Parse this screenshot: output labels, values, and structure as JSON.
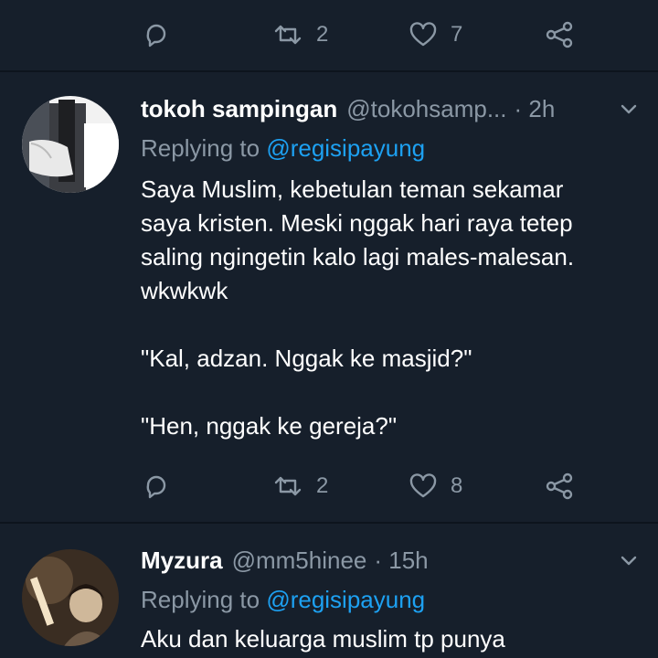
{
  "top_actions": {
    "retweet_count": "2",
    "like_count": "7"
  },
  "tweets": [
    {
      "display_name": "tokoh sampingan",
      "handle": "@tokohsamp...",
      "time": "· 2h",
      "replying_prefix": "Replying to",
      "replying_to": "@regisipayung",
      "lines": [
        "Saya Muslim, kebetulan teman sekamar",
        "saya kristen. Meski nggak hari raya tetep",
        "saling ngingetin kalo lagi males-malesan.",
        "wkwkwk",
        "\"Kal, adzan. Nggak ke masjid?\"",
        "\"Hen, nggak ke gereja?\""
      ],
      "retweet_count": "2",
      "like_count": "8"
    },
    {
      "display_name": "Myzura",
      "handle": "@mm5hinee",
      "time": "· 15h",
      "replying_prefix": "Replying to",
      "replying_to": "@regisipayung",
      "lines": [
        "Aku dan keluarga muslim tp punya"
      ]
    }
  ],
  "colors": {
    "background": "#161f2b",
    "divider": "#0d141d",
    "muted": "#8b98a5",
    "link": "#1da1f2"
  },
  "icons": [
    "reply-icon",
    "retweet-icon",
    "like-icon",
    "share-icon",
    "chevron-down-icon"
  ]
}
